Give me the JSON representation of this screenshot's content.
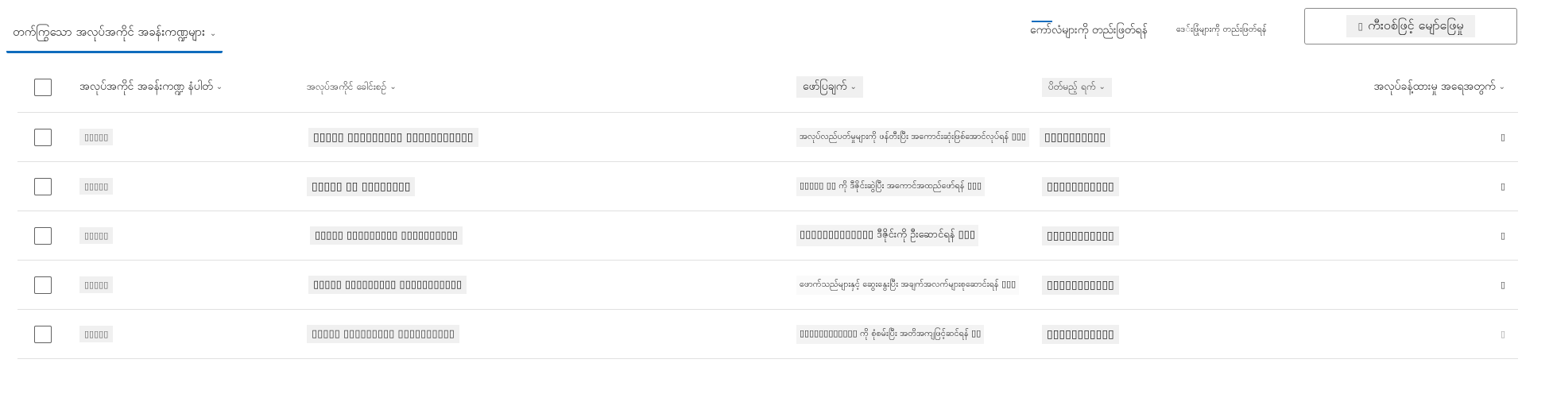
{
  "toolbar": {
    "active_tab_label": "တက်ကြွသော အလုပ်အကိုင် အခန်းကဏ္ဍများ",
    "active_tab_caret": "⌄",
    "edit_label": "ကော်လံများကို တည်းဖြတ်ရန်",
    "delete_label": "ဒေ်းဖြုံများကို တည်းဖြတ်ရန်",
    "map_glyph": "▯",
    "map_label": "ကီးဝစ်ဖြင့် မျော်ဖြေမှု"
  },
  "table": {
    "headers": {
      "select_all_checkbox": "",
      "job_role_number": "အလုပ်အကိုင် အခန်းကဏ္ဍ နံပါတ်",
      "job_role_title": "အလုပ်အကိုင် ခေါင်းစဉ်",
      "description": "ဖော်ပြချက်",
      "due_date": "ပိတ်မည့် ရက်",
      "hours_needed": "အလုပ်ခန့်ထားမှု အရေအတွက်",
      "sort_caret": "⌄"
    },
    "rows": [
      {
        "number": "▯▯▯▯▯",
        "title": "▯▯▯▯▯ ▯▯▯▯▯▯▯▯▯ ▯▯▯▯▯▯▯▯▯▯▯",
        "description": "အလုပ်လည်ပတ်မှုများကို ဖန်တီးပြီး အကောင်းဆုံးဖြစ်အောင်လုပ်ရန် ▯▯▯",
        "due_date": "▯▯▯▯▯▯▯▯▯▯",
        "hours": "▯"
      },
      {
        "number": "▯▯▯▯▯",
        "title": "▯▯▯▯▯ ▯▯ ▯▯▯▯▯▯▯▯",
        "description": "▯▯▯▯▯ ▯▯ ကို ဒီဇိုင်းဆွဲပြီး အကောင်အထည်ဖော်ရန် ▯▯▯",
        "due_date": "▯▯▯▯▯▯▯▯▯▯▯",
        "hours": "▯"
      },
      {
        "number": "▯▯▯▯▯",
        "title": "▯▯▯▯▯ ▯▯▯▯▯▯▯▯▯ ▯▯▯▯▯▯▯▯▯▯",
        "description": "▯▯▯▯▯▯▯▯▯▯▯▯▯ ဒီဇိုင်းကို ဦးဆောင်ရန် ▯▯▯",
        "due_date": "▯▯▯▯▯▯▯▯▯▯▯",
        "hours": "▯"
      },
      {
        "number": "▯▯▯▯▯",
        "title": "▯▯▯▯▯ ▯▯▯▯▯▯▯▯▯ ▯▯▯▯▯▯▯▯▯▯▯",
        "description": "ဖောက်သည်များနှင့် ဆွေးနွေးပြီး အချက်အလက်များစုဆောင်းရန် ▯▯▯",
        "due_date": "▯▯▯▯▯▯▯▯▯▯▯",
        "hours": "▯"
      },
      {
        "number": "▯▯▯▯▯",
        "title": "▯▯▯▯▯ ▯▯▯▯▯▯▯▯▯ ▯▯▯▯▯▯▯▯▯▯",
        "description": "▯▯▯▯▯▯▯▯▯▯▯▯ ကို စုံစမ်းပြီး အတိအကျဖြင့်ဆင်ရန် ▯▯",
        "due_date": "▯▯▯▯▯▯▯▯▯▯▯",
        "hours": "▯"
      }
    ]
  },
  "colors": {
    "accent": "#0f6cbd",
    "row_border": "#e0e0e0",
    "text": "#242424"
  }
}
